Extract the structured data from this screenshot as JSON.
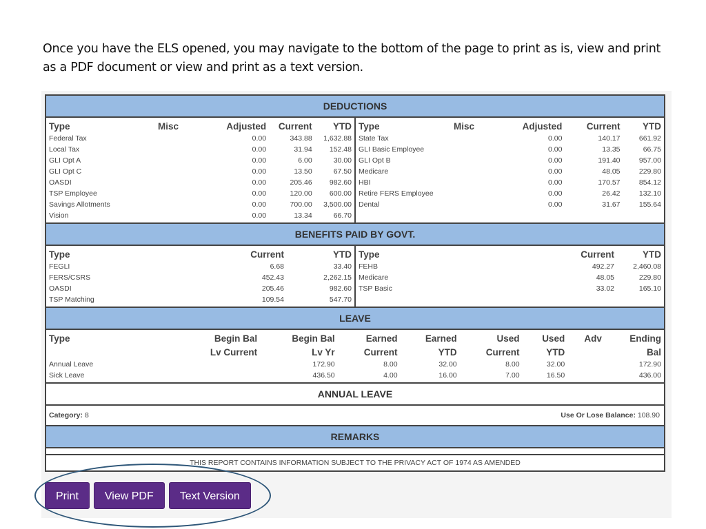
{
  "intro_text": "Once you have the ELS opened, you may navigate to the bottom of the page to print as is, view and print as a PDF document or view and print as a text version.",
  "deductions": {
    "title": "DEDUCTIONS",
    "columns": [
      "Type",
      "Misc",
      "Adjusted",
      "Current",
      "YTD"
    ],
    "left": [
      {
        "type": "Federal Tax",
        "misc": "",
        "adjusted": "0.00",
        "current": "343.88",
        "ytd": "1,632.88"
      },
      {
        "type": "Local Tax",
        "misc": "",
        "adjusted": "0.00",
        "current": "31.94",
        "ytd": "152.48"
      },
      {
        "type": "GLI Opt A",
        "misc": "",
        "adjusted": "0.00",
        "current": "6.00",
        "ytd": "30.00"
      },
      {
        "type": "GLI Opt C",
        "misc": "",
        "adjusted": "0.00",
        "current": "13.50",
        "ytd": "67.50"
      },
      {
        "type": "OASDI",
        "misc": "",
        "adjusted": "0.00",
        "current": "205.46",
        "ytd": "982.60"
      },
      {
        "type": "TSP Employee",
        "misc": "",
        "adjusted": "0.00",
        "current": "120.00",
        "ytd": "600.00"
      },
      {
        "type": "Savings Allotments",
        "misc": "",
        "adjusted": "0.00",
        "current": "700.00",
        "ytd": "3,500.00"
      },
      {
        "type": "Vision",
        "misc": "",
        "adjusted": "0.00",
        "current": "13.34",
        "ytd": "66.70"
      }
    ],
    "right": [
      {
        "type": "State Tax",
        "misc": "",
        "adjusted": "0.00",
        "current": "140.17",
        "ytd": "661.92"
      },
      {
        "type": "GLI Basic Employee",
        "misc": "",
        "adjusted": "0.00",
        "current": "13.35",
        "ytd": "66.75"
      },
      {
        "type": "GLI Opt B",
        "misc": "",
        "adjusted": "0.00",
        "current": "191.40",
        "ytd": "957.00"
      },
      {
        "type": "Medicare",
        "misc": "",
        "adjusted": "0.00",
        "current": "48.05",
        "ytd": "229.80"
      },
      {
        "type": "HBI",
        "misc": "",
        "adjusted": "0.00",
        "current": "170.57",
        "ytd": "854.12"
      },
      {
        "type": "Retire FERS Employee",
        "misc": "",
        "adjusted": "0.00",
        "current": "26.42",
        "ytd": "132.10"
      },
      {
        "type": "Dental",
        "misc": "",
        "adjusted": "0.00",
        "current": "31.67",
        "ytd": "155.64"
      }
    ]
  },
  "benefits": {
    "title": "BENEFITS PAID BY GOVT.",
    "columns": [
      "Type",
      "Current",
      "YTD"
    ],
    "left": [
      {
        "type": "FEGLI",
        "current": "6.68",
        "ytd": "33.40"
      },
      {
        "type": "FERS/CSRS",
        "current": "452.43",
        "ytd": "2,262.15"
      },
      {
        "type": "OASDI",
        "current": "205.46",
        "ytd": "982.60"
      },
      {
        "type": "TSP Matching",
        "current": "109.54",
        "ytd": "547.70"
      }
    ],
    "right": [
      {
        "type": "FEHB",
        "current": "492.27",
        "ytd": "2,460.08"
      },
      {
        "type": "Medicare",
        "current": "48.05",
        "ytd": "229.80"
      },
      {
        "type": "TSP Basic",
        "current": "33.02",
        "ytd": "165.10"
      }
    ]
  },
  "leave": {
    "title": "LEAVE",
    "columns_line1": [
      "Type",
      "Begin Bal",
      "Begin Bal",
      "Earned",
      "Earned",
      "Used",
      "Used",
      "Adv",
      "Ending"
    ],
    "columns_line2": [
      "",
      "Lv Current",
      "Lv Yr",
      "Current",
      "YTD",
      "Current",
      "YTD",
      "",
      "Bal"
    ],
    "rows": [
      [
        "Annual Leave",
        "",
        "172.90",
        "8.00",
        "32.00",
        "8.00",
        "32.00",
        "",
        "172.90"
      ],
      [
        "Sick Leave",
        "",
        "436.50",
        "4.00",
        "16.00",
        "7.00",
        "16.50",
        "",
        "436.00"
      ]
    ]
  },
  "annual_leave": {
    "title": "ANNUAL LEAVE",
    "category_label": "Category:",
    "category_value": "8",
    "use_or_lose_label": "Use Or Lose Balance:",
    "use_or_lose_value": "108.90"
  },
  "remarks": {
    "title": "REMARKS",
    "privacy_notice": "THIS REPORT CONTAINS INFORMATION SUBJECT TO THE PRIVACY ACT OF 1974 AS AMENDED"
  },
  "buttons": {
    "print": "Print",
    "view_pdf": "View PDF",
    "text_version": "Text Version"
  },
  "colors": {
    "section_header": "#98bbe3",
    "button": "#5b2c87",
    "highlight_ellipse": "#2f5779"
  }
}
